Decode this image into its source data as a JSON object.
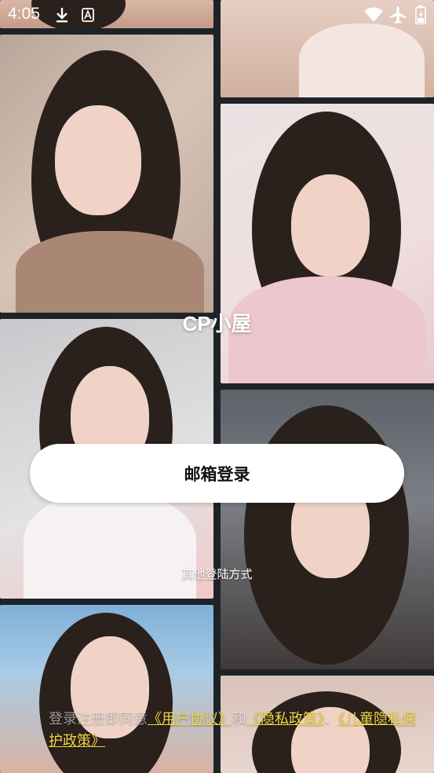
{
  "status_bar": {
    "time": "4:05",
    "left_icons": [
      "download-icon",
      "a-box-icon"
    ],
    "right_icons": [
      "wifi-icon",
      "airplane-icon",
      "battery-icon"
    ]
  },
  "app": {
    "title": "CP小屋"
  },
  "login": {
    "email_button_label": "邮箱登录",
    "other_methods_label": "其他登陆方式"
  },
  "agreement": {
    "prefix": "登录注册即同意",
    "user_agreement": "《用户协议》",
    "and": "和",
    "privacy_policy": "《隐私政策》",
    "separator": "、",
    "child_privacy_policy": "《儿童隐私保护政策》"
  },
  "colors": {
    "link": "#f4d742",
    "background": "#1e2328",
    "button_bg": "#ffffff"
  }
}
